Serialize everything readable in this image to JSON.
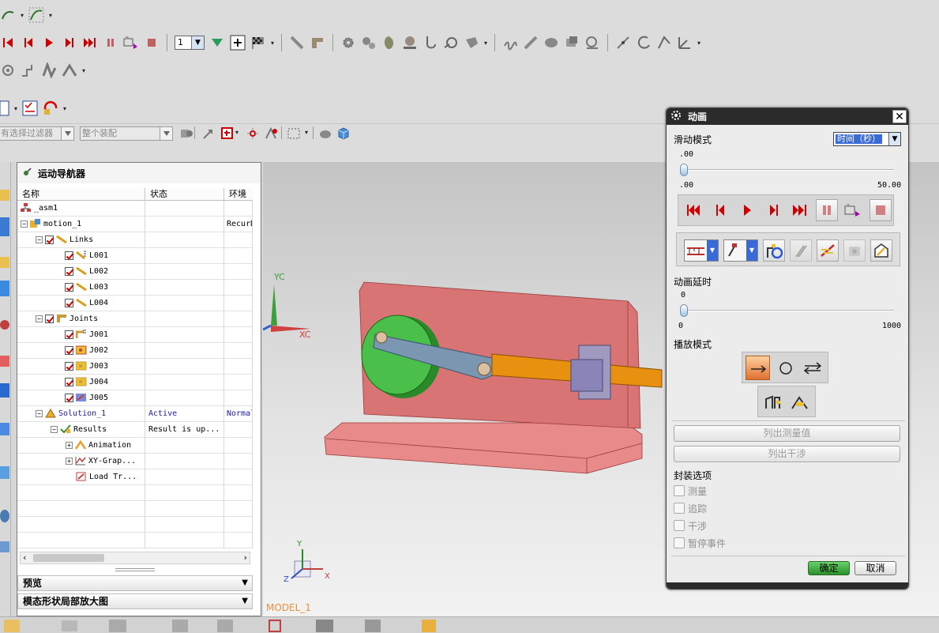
{
  "navigator": {
    "title": "运动导航器",
    "columns": [
      "名称",
      "状态",
      "环境"
    ],
    "rows": [
      {
        "name": "_asm1",
        "status": "",
        "env": ""
      },
      {
        "name": "motion_1",
        "status": "",
        "env": "RecurDyn"
      },
      {
        "name": "Links",
        "status": "",
        "env": ""
      },
      {
        "name": "L001",
        "status": "",
        "env": ""
      },
      {
        "name": "L002",
        "status": "",
        "env": ""
      },
      {
        "name": "L003",
        "status": "",
        "env": ""
      },
      {
        "name": "L004",
        "status": "",
        "env": ""
      },
      {
        "name": "Joints",
        "status": "",
        "env": ""
      },
      {
        "name": "J001",
        "status": "",
        "env": ""
      },
      {
        "name": "J002",
        "status": "",
        "env": ""
      },
      {
        "name": "J003",
        "status": "",
        "env": ""
      },
      {
        "name": "J004",
        "status": "",
        "env": ""
      },
      {
        "name": "J005",
        "status": "",
        "env": ""
      },
      {
        "name": "Solution_1",
        "status": "Active",
        "env": "Normal"
      },
      {
        "name": "Results",
        "status": "Result is up...",
        "env": ""
      },
      {
        "name": "Animation",
        "status": "",
        "env": ""
      },
      {
        "name": "XY-Grap...",
        "status": "",
        "env": ""
      },
      {
        "name": "Load Tr...",
        "status": "",
        "env": ""
      }
    ],
    "panels": {
      "preview": "预览",
      "magnify": "模态形状局部放大图"
    }
  },
  "filter_bar": {
    "filter_placeholder": "有选择过滤器",
    "scope_placeholder": "整个装配"
  },
  "toolbar": {
    "step_value": "1"
  },
  "viewport": {
    "model_label": "MODEL_1",
    "axis_yc": "YC",
    "axis_xc": "XC",
    "triad_x": "X",
    "triad_y": "Y",
    "triad_z": "Z"
  },
  "dialog": {
    "title": "动画",
    "slide_mode_label": "滑动模式",
    "slide_mode_value": "时间（秒）",
    "time_current": ".00",
    "time_min": ".00",
    "time_max": "50.00",
    "time_position": 0,
    "delay_label": "动画延时",
    "delay_current": "0",
    "delay_min": "0",
    "delay_max": "1000",
    "delay_position": 0,
    "play_mode_label": "播放模式",
    "list_measure": "列出测量值",
    "list_interference": "列出干涉",
    "package_options_label": "封装选项",
    "options": [
      "测量",
      "追踪",
      "干涉",
      "暂停事件"
    ],
    "ok": "确定",
    "cancel": "取消"
  }
}
